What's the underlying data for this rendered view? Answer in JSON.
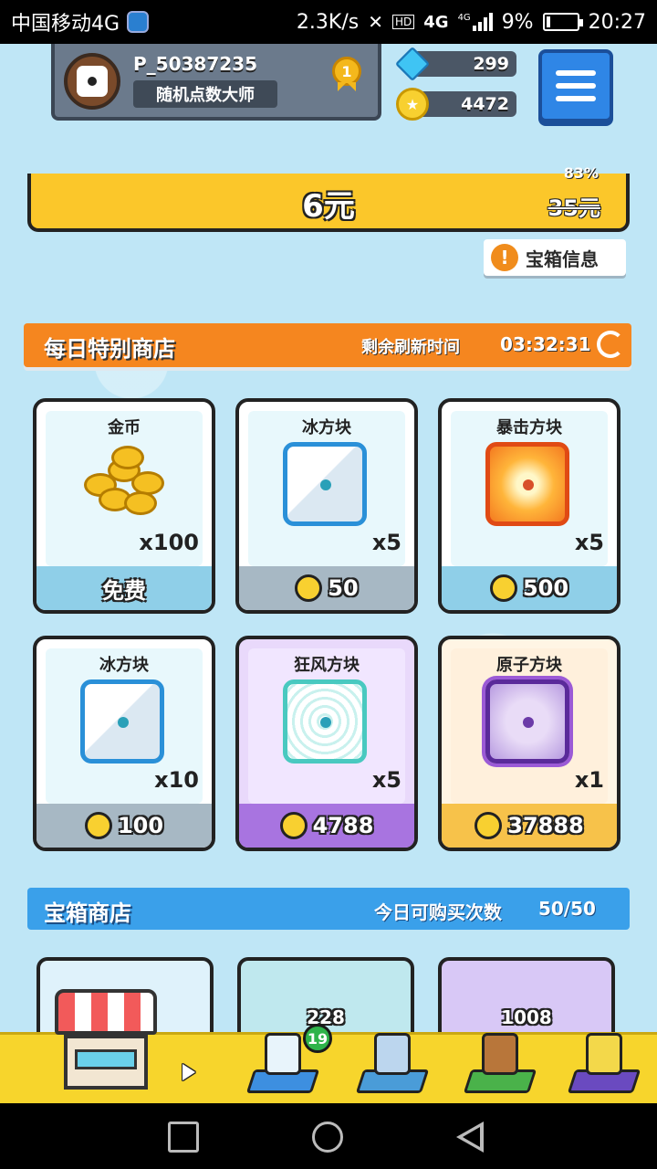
{
  "status_bar": {
    "carrier": "中国移动4G",
    "speed": "2.3K/s",
    "network_hd": "HD",
    "network_4g": "4G",
    "network_4g_small": "4G",
    "battery": "9%",
    "time": "20:27"
  },
  "player": {
    "name": "P_50387235",
    "title": "随机点数大师",
    "rank": "1"
  },
  "currency": {
    "gems": "299",
    "coins": "4472"
  },
  "offer": {
    "price": "6元",
    "old_price": "35元",
    "discount": "83%"
  },
  "chest_info_label": "宝箱信息",
  "daily_shop": {
    "title": "每日特别商店",
    "refresh_label": "剩余刷新时间",
    "timer": "03:32:31",
    "items": [
      {
        "name": "金币",
        "qty": "x100",
        "price": "免费"
      },
      {
        "name": "冰方块",
        "qty": "x5",
        "price": "50"
      },
      {
        "name": "暴击方块",
        "qty": "x5",
        "price": "500"
      },
      {
        "name": "冰方块",
        "qty": "x10",
        "price": "100"
      },
      {
        "name": "狂风方块",
        "qty": "x5",
        "price": "4788"
      },
      {
        "name": "原子方块",
        "qty": "x1",
        "price": "37888"
      }
    ]
  },
  "chest_shop": {
    "title": "宝箱商店",
    "count_label": "今日可购买次数",
    "count": "50/50",
    "chests": [
      {
        "amount": ""
      },
      {
        "amount": "228"
      },
      {
        "amount": "1008"
      }
    ]
  },
  "bottom_nav": {
    "badge": "19"
  },
  "colors": {
    "daily_header": "#f5861f",
    "chest_header": "#3aa0ea",
    "offer_yellow": "#fbc72a",
    "menu_blue": "#2f86e6"
  }
}
